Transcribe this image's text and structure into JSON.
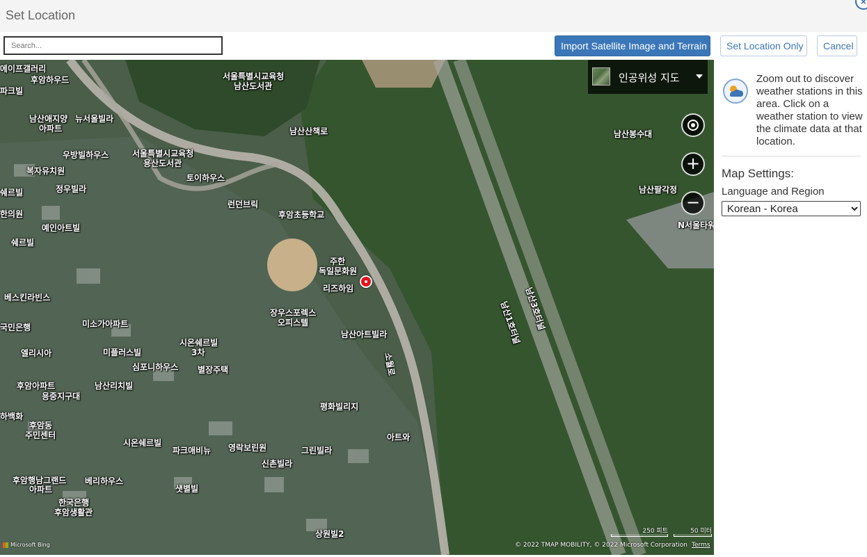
{
  "dialog": {
    "title": "Set Location"
  },
  "toolbar": {
    "search_placeholder": "Search...",
    "import_label": "Import Satellite Image and Terrain",
    "set_location_label": "Set Location Only",
    "cancel_label": "Cancel"
  },
  "map": {
    "map_type_label": "인공위성 지도",
    "controls": {
      "locate_icon": "locate-icon",
      "zoom_in": "+",
      "zoom_out": "−"
    },
    "labels": [
      "에이프갤러리",
      "후암하우드",
      "서울특별시교육청",
      "남산도서관",
      "파크빌",
      "남산애지양",
      "아파트",
      "뉴서울빌라",
      "남산산책로",
      "남산봉수대",
      "우방빌하우스",
      "서울특별시교육청",
      "용산도서관",
      "복자유치원",
      "토이하우스",
      "정우빌라",
      "남산팔각정",
      "쉐르빌",
      "런던브릭",
      "후암초등학교",
      "N서울타워",
      "한의원",
      "예인아트빌",
      "쉐르빌",
      "주한",
      "독일문화원",
      "리즈하임",
      "베스킨라빈스",
      "장우스포렉스",
      "오피스텔",
      "남산아트빌라",
      "미소가아파트",
      "남산1호터널",
      "남산3호터널",
      "시온쉐르빌",
      "3차",
      "국민은행",
      "엘리시아",
      "미플러스빌",
      "소월로",
      "심포니하우스",
      "별장주택",
      "후암아파트",
      "남산리치빌",
      "용중지구대",
      "평화빌리지",
      "하백화",
      "후암동",
      "주민센터",
      "시온쉐르빌",
      "파크애비뉴",
      "영락보린원",
      "그린빌라",
      "아트와",
      "신촌빌라",
      "후암행남그랜드",
      "아파트",
      "베리하우스",
      "샛별빌",
      "한국은행",
      "후암생활관",
      "상원빌2"
    ],
    "scale": {
      "primary": "250 피트",
      "secondary": "50 미터"
    },
    "attribution": "© 2022 TMAP MOBILITY, © 2022 Microsoft Corporation",
    "terms_label": "Terms",
    "bing_label": "Microsoft Bing"
  },
  "panel": {
    "info_text": "Zoom out to discover weather stations in this area. Click on a weather station to view the climate data at that location.",
    "settings_title": "Map Settings:",
    "language_label": "Language and Region",
    "language_value": "Korean - Korea"
  },
  "colors": {
    "primary": "#3b77b8",
    "pin": "#e8101a",
    "forest": "#35552e"
  }
}
